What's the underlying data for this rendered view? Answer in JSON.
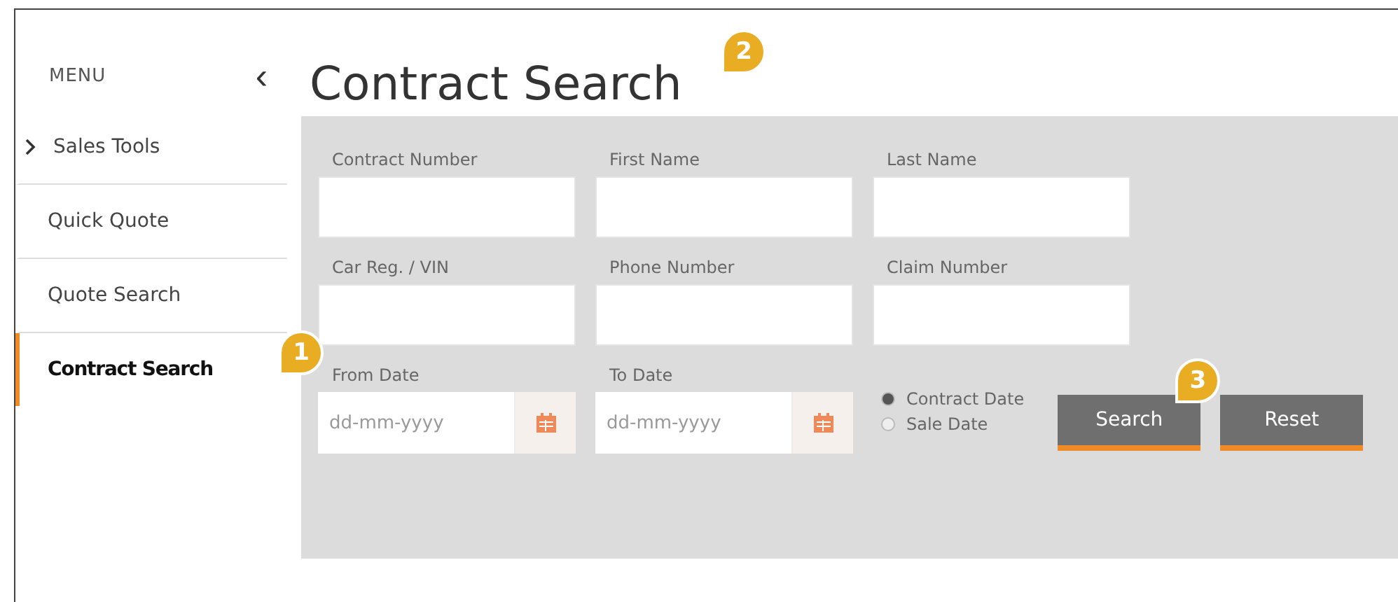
{
  "sidebar": {
    "title": "MENU",
    "collapse_icon": "‹",
    "items": [
      {
        "label": "Sales Tools",
        "kind": "group",
        "selected": false
      },
      {
        "label": "Quick Quote",
        "kind": "link",
        "selected": false
      },
      {
        "label": "Quote Search",
        "kind": "link",
        "selected": false
      },
      {
        "label": "Contract Search",
        "kind": "link",
        "selected": true,
        "callout": "1"
      }
    ]
  },
  "page": {
    "title": "Contract Search",
    "title_callout": "2"
  },
  "form": {
    "rows": [
      [
        {
          "label": "Contract Number",
          "kind": "text"
        },
        {
          "label": "First Name",
          "kind": "text"
        },
        {
          "label": "Last Name",
          "kind": "text"
        }
      ],
      [
        {
          "label": "Car Reg. / VIN",
          "kind": "text"
        },
        {
          "label": "Phone Number",
          "kind": "text"
        },
        {
          "label": "Claim Number",
          "kind": "text"
        }
      ],
      [
        {
          "label": "From Date",
          "kind": "date",
          "placeholder": "dd-mm-yyyy"
        },
        {
          "label": "To Date",
          "kind": "date",
          "placeholder": "dd-mm-yyyy"
        }
      ]
    ],
    "date_type": [
      {
        "label": "Contract Date",
        "selected": true
      },
      {
        "label": "Sale Date",
        "selected": false
      }
    ],
    "buttons": [
      {
        "label": "Search",
        "callout": "3"
      },
      {
        "label": "Reset"
      }
    ]
  }
}
